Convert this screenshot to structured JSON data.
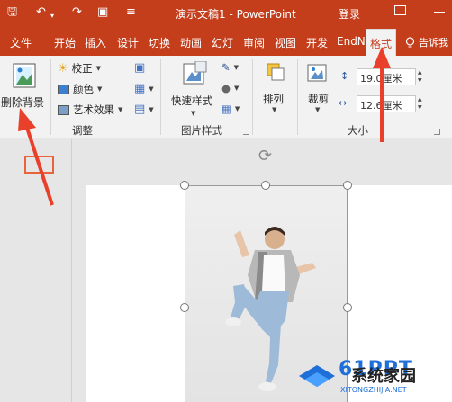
{
  "titlebar": {
    "title": "演示文稿1 - PowerPoint",
    "login": "登录",
    "quick_access": [
      "save-icon",
      "undo-icon",
      "redo-icon",
      "present-icon",
      "customize-icon"
    ]
  },
  "tabs": [
    "文件",
    "开始",
    "插入",
    "设计",
    "切换",
    "动画",
    "幻灯",
    "审阅",
    "视图",
    "开发",
    "EndN",
    "格式"
  ],
  "active_tab": "格式",
  "tell_me": "告诉我",
  "ribbon": {
    "remove_bg": "删除背景",
    "adjust": {
      "corrections": "校正",
      "color": "颜色",
      "artistic": "艺术效果",
      "label": "调整"
    },
    "styles": {
      "quick_styles": "快速样式",
      "label": "图片样式"
    },
    "arrange": {
      "label": "排列"
    },
    "crop": {
      "label": "裁剪"
    },
    "size": {
      "height": "19.0厘米",
      "width": "12.6厘米",
      "label": "大小"
    }
  },
  "watermark": {
    "brand": "系统家园",
    "url": "XITONGZHIJIA.NET",
    "badge": "61PPT"
  },
  "colors": {
    "accent": "#c43e1c",
    "annotation_red": "#e8402a"
  }
}
